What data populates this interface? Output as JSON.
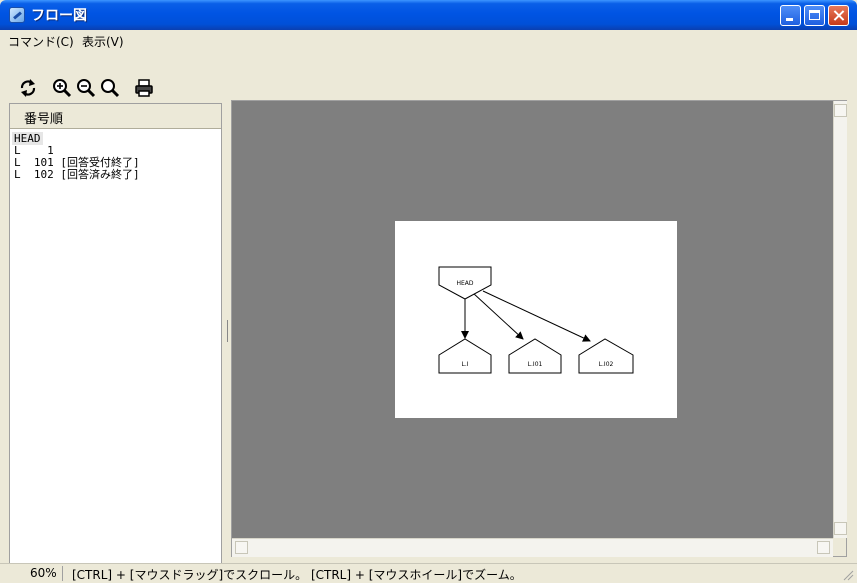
{
  "window": {
    "title": "フロー図"
  },
  "menu": {
    "items": [
      "コマンド(C)",
      "表示(V)"
    ]
  },
  "toolbar": {
    "icons": [
      "refresh-icon",
      "zoom-in-icon",
      "zoom-out-icon",
      "zoom-fit-icon",
      "print-icon"
    ]
  },
  "list": {
    "header": "番号順",
    "rows": [
      "HEAD",
      "L    1",
      "L  101 [回答受付終了]",
      "L  102 [回答済み終了]"
    ]
  },
  "diagram": {
    "nodes": {
      "head": "HEAD",
      "n1": "L.I",
      "n2": "L.I01",
      "n3": "L.I02"
    }
  },
  "status": {
    "zoom": "60%",
    "message": "[CTRL] + [マウスドラッグ]でスクロール。 [CTRL] + [マウスホイール]でズーム。"
  }
}
